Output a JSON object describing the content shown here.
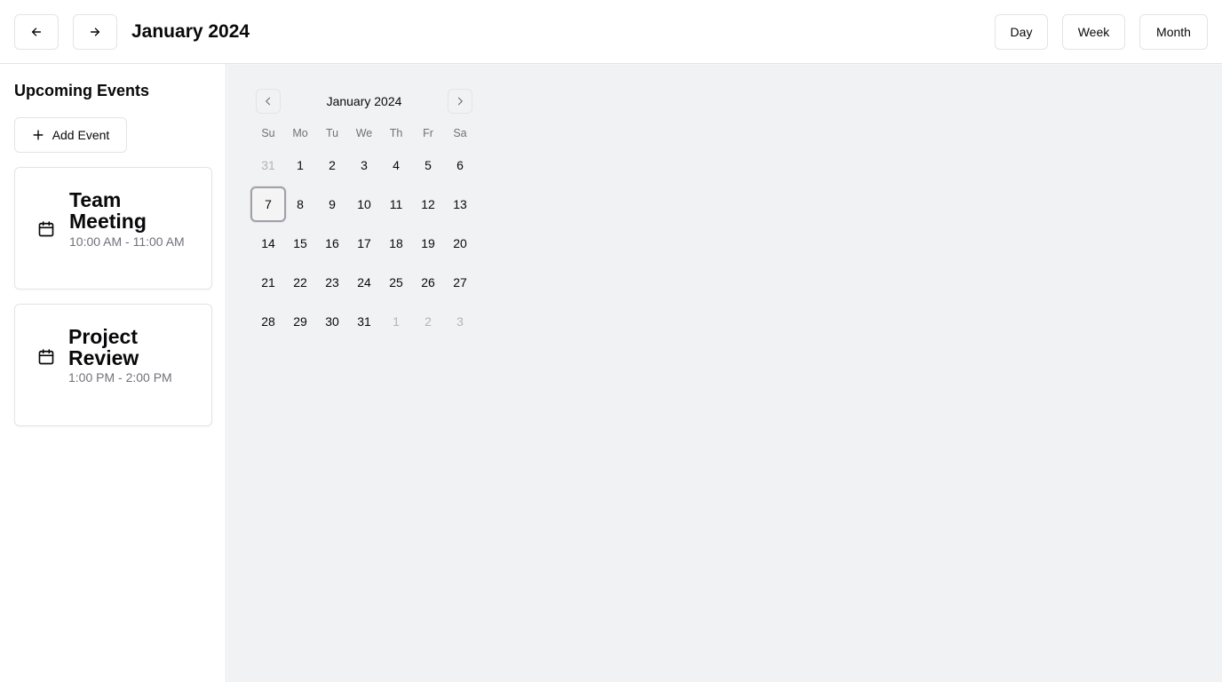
{
  "header": {
    "title": "January 2024",
    "prev_icon": "arrow-left-icon",
    "next_icon": "arrow-right-icon",
    "views": [
      "Day",
      "Week",
      "Month"
    ]
  },
  "sidebar": {
    "heading": "Upcoming Events",
    "add_label": "Add Event",
    "events": [
      {
        "title": "Team Meeting",
        "time": "10:00 AM - 11:00 AM",
        "icon": "calendar-icon"
      },
      {
        "title": "Project Review",
        "time": "1:00 PM - 2:00 PM",
        "icon": "calendar-icon"
      }
    ]
  },
  "calendar": {
    "month_label": "January 2024",
    "weekdays": [
      "Su",
      "Mo",
      "Tu",
      "We",
      "Th",
      "Fr",
      "Sa"
    ],
    "weeks": [
      [
        "31",
        "1",
        "2",
        "3",
        "4",
        "5",
        "6"
      ],
      [
        "7",
        "8",
        "9",
        "10",
        "11",
        "12",
        "13"
      ],
      [
        "14",
        "15",
        "16",
        "17",
        "18",
        "19",
        "20"
      ],
      [
        "21",
        "22",
        "23",
        "24",
        "25",
        "26",
        "27"
      ],
      [
        "28",
        "29",
        "30",
        "31",
        "1",
        "2",
        "3"
      ]
    ],
    "outside_days": [
      "0-0",
      "4-4",
      "4-5",
      "4-6"
    ],
    "selected_day": "1-0"
  },
  "colors": {
    "border": "#e4e4e7",
    "muted_text": "#71717a",
    "outside_day_text": "#b4b4b9",
    "main_background": "#f1f2f4"
  }
}
